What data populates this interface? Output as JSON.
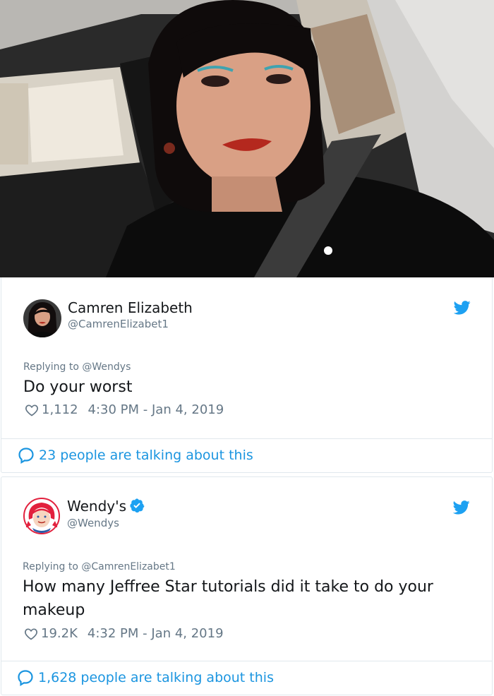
{
  "tweets": [
    {
      "name": "Camren Elizabeth",
      "handle": "@CamrenElizabet1",
      "reply_prefix": "Replying to ",
      "reply_to": "@Wendys",
      "text": "Do your worst",
      "likes": "1,112",
      "timestamp": "4:30 PM - Jan 4, 2019",
      "talking": "23 people are talking about this",
      "verified": false
    },
    {
      "name": "Wendy's",
      "handle": "@Wendys",
      "reply_prefix": "Replying to ",
      "reply_to": "@CamrenElizabet1",
      "text_line1": "How many Jeffree Star tutorials did it take to do your",
      "text_line2": "makeup",
      "likes": "19.2K",
      "timestamp": "4:32 PM - Jan 4, 2019",
      "talking": "1,628 people are talking about this",
      "verified": true
    }
  ],
  "colors": {
    "twitter_blue": "#1da1f2",
    "link_blue": "#1b95e0",
    "secondary_text": "#657786",
    "border": "#e1e8ed"
  },
  "icons": [
    "twitter-bird-icon",
    "heart-icon",
    "speech-bubble-icon",
    "verified-badge-icon"
  ]
}
